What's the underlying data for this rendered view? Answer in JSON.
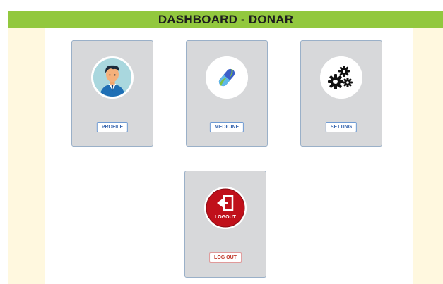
{
  "header": {
    "title": "DASHBOARD - DONAR"
  },
  "cards": {
    "profile": {
      "button_label": "PROFILE",
      "icon": "user-avatar-icon"
    },
    "medicine": {
      "button_label": "MEDICINE",
      "icon": "capsule-icon"
    },
    "setting": {
      "button_label": "SETTING",
      "icon": "gears-icon"
    },
    "logout": {
      "button_label": "LOG OUT",
      "icon": "logout-icon",
      "icon_text": "LOGOUT"
    }
  },
  "colors": {
    "header_bg": "#92c83e",
    "side_bg": "#fff8df",
    "card_bg": "#d7d8da",
    "button_border": "#6f9bd3",
    "logout_red": "#c0101a"
  }
}
